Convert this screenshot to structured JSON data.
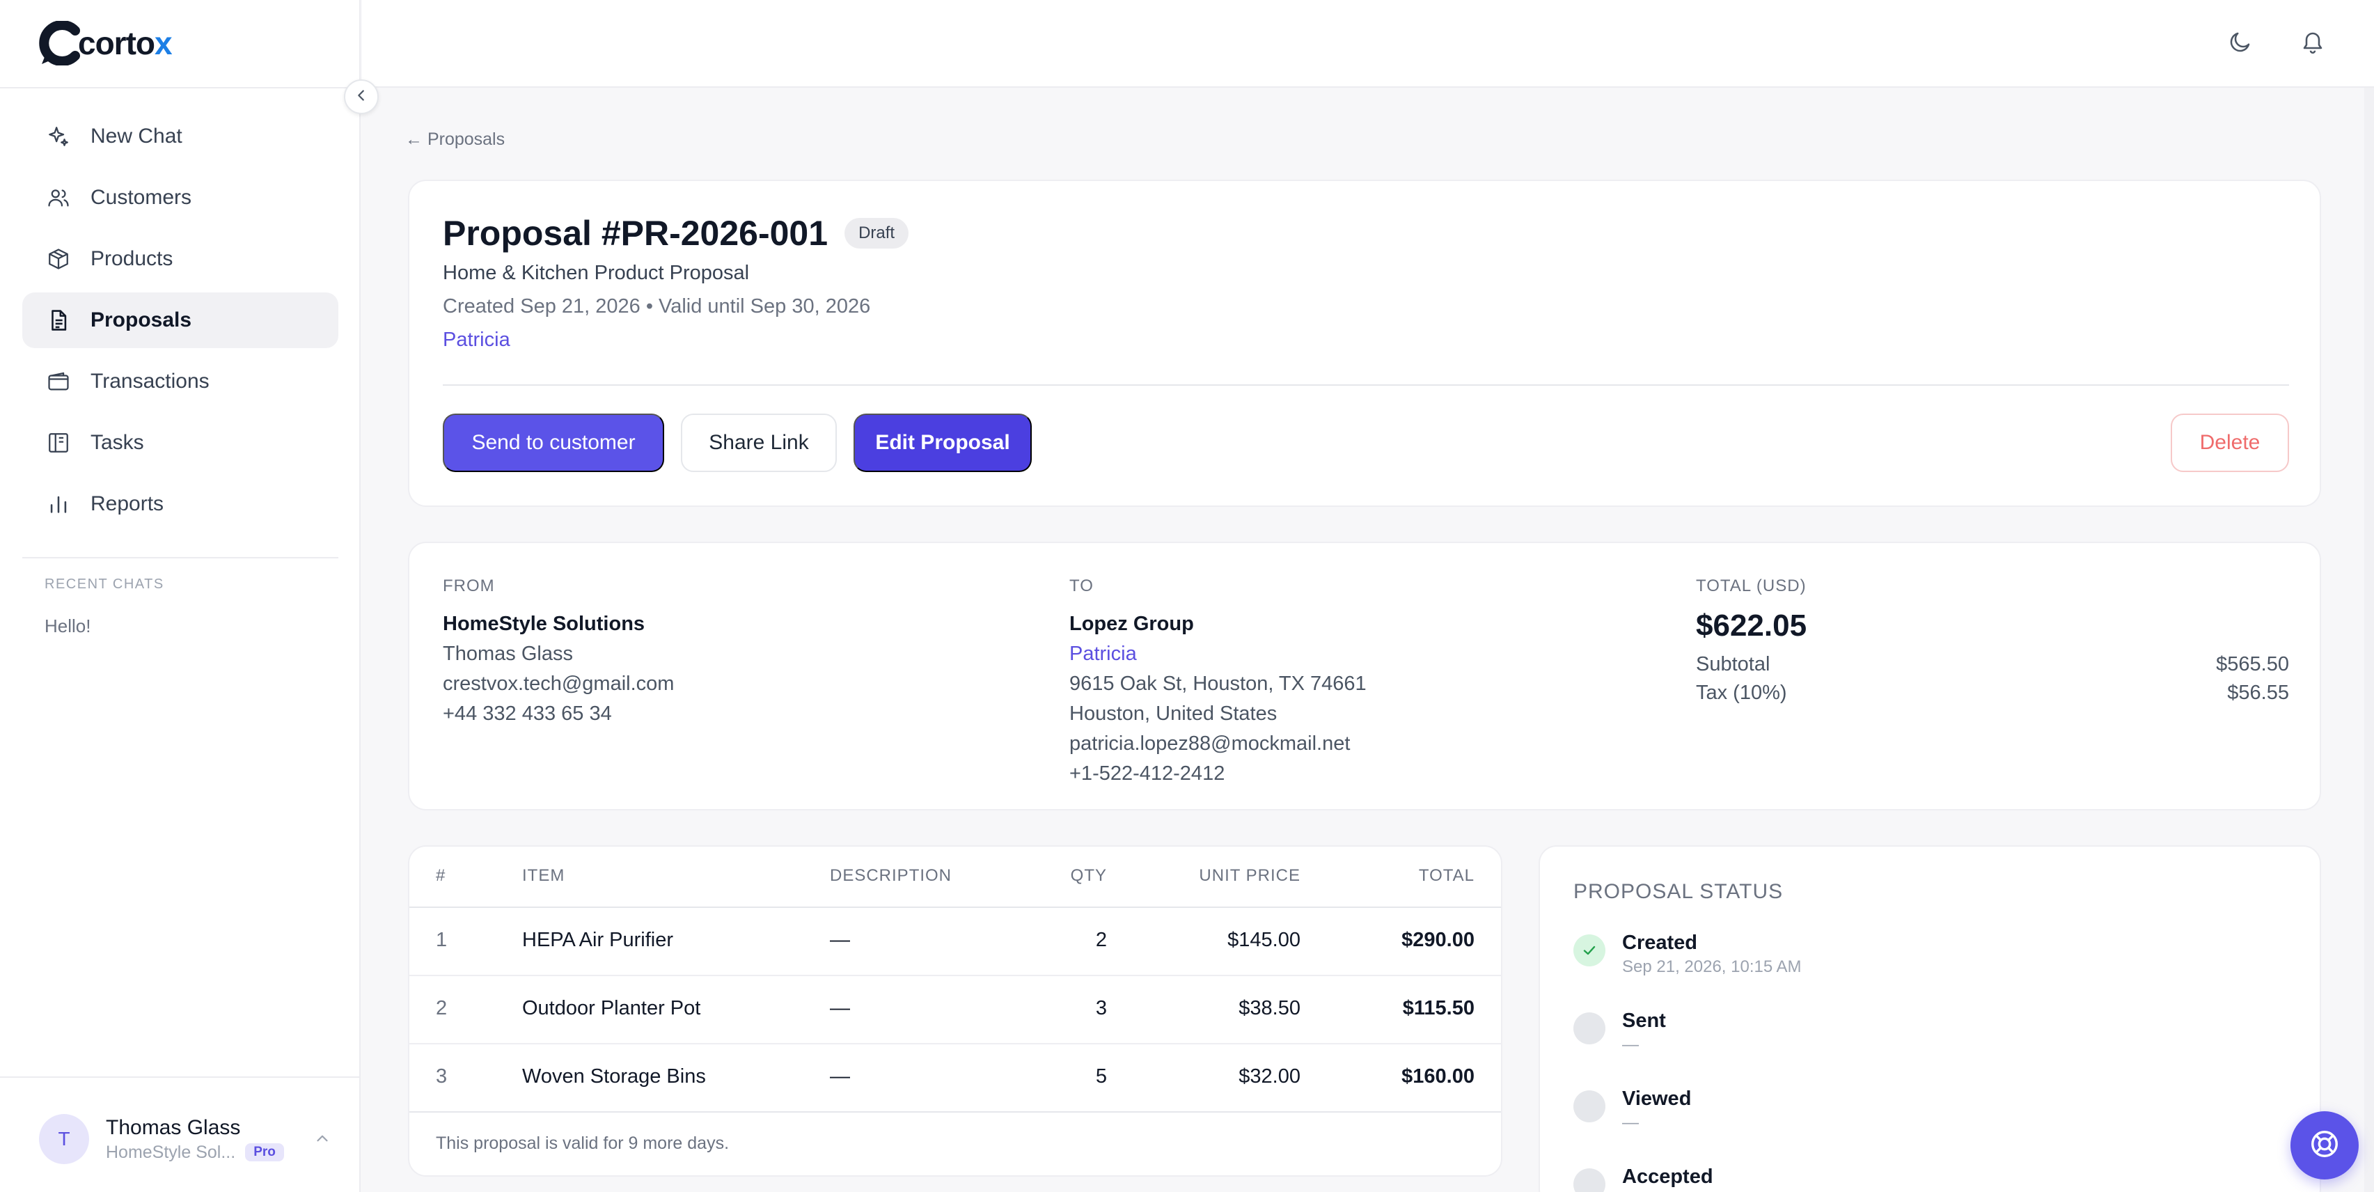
{
  "brand": {
    "name_prefix": "corto",
    "name_suffix": "x"
  },
  "sidebar": {
    "items": [
      {
        "label": "New Chat",
        "icon": "sparkle-icon"
      },
      {
        "label": "Customers",
        "icon": "users-icon"
      },
      {
        "label": "Products",
        "icon": "box-icon"
      },
      {
        "label": "Proposals",
        "icon": "document-icon",
        "active": true
      },
      {
        "label": "Transactions",
        "icon": "wallet-icon"
      },
      {
        "label": "Tasks",
        "icon": "kanban-icon"
      },
      {
        "label": "Reports",
        "icon": "bar-chart-icon"
      }
    ],
    "recent_label": "RECENT CHATS",
    "recent_chats": [
      "Hello!"
    ],
    "user": {
      "initial": "T",
      "name": "Thomas Glass",
      "company": "HomeStyle Sol...",
      "plan": "Pro"
    }
  },
  "breadcrumb": {
    "back": "← Proposals"
  },
  "proposal": {
    "title": "Proposal #PR-2026-001",
    "status": "Draft",
    "subtitle": "Home & Kitchen Product Proposal",
    "dates": "Created Sep 21, 2026 • Valid until Sep 30, 2026",
    "customer": "Patricia"
  },
  "actions": {
    "send": "Send to customer",
    "share": "Share Link",
    "edit": "Edit Proposal",
    "delete": "Delete"
  },
  "parties": {
    "from": {
      "label": "FROM",
      "company": "HomeStyle Solutions",
      "contact": "Thomas Glass",
      "email": "crestvox.tech@gmail.com",
      "phone": "+44 332 433 65 34"
    },
    "to": {
      "label": "TO",
      "company": "Lopez Group",
      "contact": "Patricia",
      "address": "9615 Oak St, Houston, TX 74661",
      "city": "Houston, United States",
      "email": "patricia.lopez88@mockmail.net",
      "phone": "+1-522-412-2412"
    },
    "totals": {
      "label": "TOTAL (USD)",
      "total": "$622.05",
      "subtotal_label": "Subtotal",
      "subtotal": "$565.50",
      "tax_label": "Tax (10%)",
      "tax": "$56.55"
    }
  },
  "items_table": {
    "headers": {
      "idx": "#",
      "item": "ITEM",
      "desc": "DESCRIPTION",
      "qty": "QTY",
      "price": "UNIT PRICE",
      "total": "TOTAL"
    },
    "rows": [
      {
        "idx": "1",
        "item": "HEPA Air Purifier",
        "desc": "—",
        "qty": "2",
        "price": "$145.00",
        "total": "$290.00"
      },
      {
        "idx": "2",
        "item": "Outdoor Planter Pot",
        "desc": "—",
        "qty": "3",
        "price": "$38.50",
        "total": "$115.50"
      },
      {
        "idx": "3",
        "item": "Woven Storage Bins",
        "desc": "—",
        "qty": "5",
        "price": "$32.00",
        "total": "$160.00"
      }
    ],
    "footer": "This proposal is valid for 9 more days."
  },
  "status_panel": {
    "title": "PROPOSAL STATUS",
    "steps": [
      {
        "name": "Created",
        "time": "Sep 21, 2026, 10:15 AM",
        "done": true
      },
      {
        "name": "Sent",
        "time": "—",
        "done": false
      },
      {
        "name": "Viewed",
        "time": "—",
        "done": false
      },
      {
        "name": "Accepted",
        "time": "",
        "done": false
      }
    ]
  },
  "colors": {
    "accent": "#5b53e8",
    "accent_dark": "#4b3fe0",
    "danger": "#ef6b6b",
    "success": "#22c55e",
    "brand_x": "#1d7fe6"
  }
}
